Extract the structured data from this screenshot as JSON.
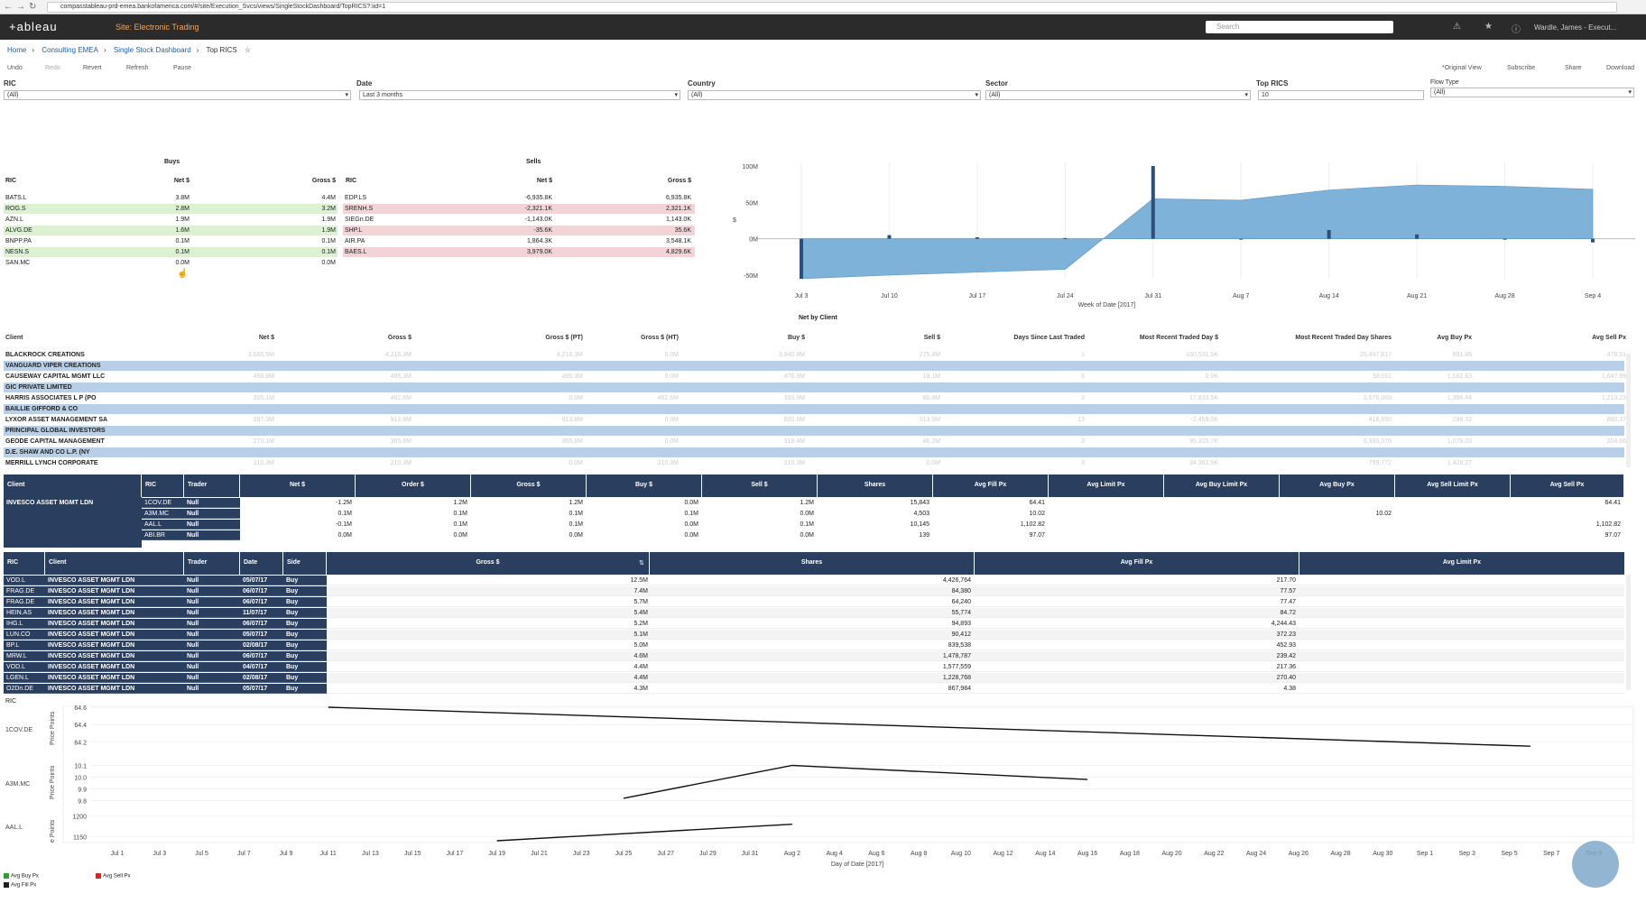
{
  "browser": {
    "url": "compasstableau-prd-emea.bankofamerica.com/#/site/Execution_Svcs/views/SingleStockDashboard/TopRICS?:iid=1"
  },
  "header": {
    "logo": "+ableau",
    "site": "Site: Electronic Trading",
    "search_placeholder": "Search",
    "user": "Wardle, James - Execut..."
  },
  "breadcrumb": {
    "home": "Home",
    "project": "Consulting EMEA",
    "workbook": "Single Stock Dashboard",
    "view": "Top RICS"
  },
  "toolbar": {
    "undo": "Undo",
    "redo": "Redo",
    "revert": "Revert",
    "refresh": "Refresh",
    "pause": "Pause",
    "original_view": "*Original View",
    "subscribe": "Subscribe",
    "share": "Share",
    "download": "Download"
  },
  "filters": {
    "ric": {
      "label": "RIC",
      "value": "(All)"
    },
    "date": {
      "label": "Date",
      "value": "Last 3 months"
    },
    "country": {
      "label": "Country",
      "value": "(All)"
    },
    "sector": {
      "label": "Sector",
      "value": "(All)"
    },
    "top_rics": {
      "label": "Top RICS",
      "value": "10"
    },
    "flow_type": {
      "label": "Flow Type",
      "value": "(All)"
    }
  },
  "buys": {
    "title": "Buys",
    "headers": [
      "RIC",
      "Net $",
      "Gross $"
    ],
    "rows": [
      [
        "BATS.L",
        "3.8M",
        "4.4M"
      ],
      [
        "ROG.S",
        "2.8M",
        "3.2M"
      ],
      [
        "AZN.L",
        "1.9M",
        "1.9M"
      ],
      [
        "ALVG.DE",
        "1.6M",
        "1.9M"
      ],
      [
        "BNPP.PA",
        "0.1M",
        "0.1M"
      ],
      [
        "NESN.S",
        "0.1M",
        "0.1M"
      ],
      [
        "SAN.MC",
        "0.0M",
        "0.0M"
      ]
    ]
  },
  "sells": {
    "title": "Sells",
    "headers": [
      "RIC",
      "Net $",
      "Gross $"
    ],
    "rows": [
      [
        "EDP.LS",
        "-6,935.8K",
        "6,935.8K"
      ],
      [
        "SRENH.S",
        "-2,321.1K",
        "2,321.1K"
      ],
      [
        "SIEGn.DE",
        "-1,143.0K",
        "1,143.0K"
      ],
      [
        "SHP.L",
        "-35.6K",
        "35.6K"
      ],
      [
        "AIR.PA",
        "1,864.3K",
        "3,548.1K"
      ],
      [
        "BAES.L",
        "3,979.0K",
        "4,829.6K"
      ]
    ]
  },
  "chart_data": [
    {
      "type": "area",
      "x": [
        "Jul 3",
        "Jul 10",
        "Jul 17",
        "Jul 24",
        "Jul 31",
        "Aug 7",
        "Aug 14",
        "Aug 21",
        "Aug 28",
        "Sep 4"
      ],
      "series": [
        {
          "values": [
            -55,
            -50,
            -46,
            -42,
            55,
            53,
            67,
            74,
            72,
            68
          ]
        }
      ],
      "bars": [
        -55,
        5,
        2,
        1,
        100,
        0,
        12,
        6,
        0,
        -5
      ],
      "ylabel": "$",
      "xlabel": "Week of Date [2017]",
      "yticks": [
        "100M",
        "50M",
        "0M",
        "-50M"
      ],
      "ylim": [
        -55,
        105
      ],
      "color": "#7fb2d9"
    },
    {
      "type": "line",
      "xlabel": "Day of Date [2017]",
      "row_header": "RIC",
      "x_ticks": [
        "Jul 1",
        "Jul 3",
        "Jul 5",
        "Jul 7",
        "Jul 9",
        "Jul 11",
        "Jul 13",
        "Jul 15",
        "Jul 17",
        "Jul 19",
        "Jul 21",
        "Jul 23",
        "Jul 25",
        "Jul 27",
        "Jul 29",
        "Jul 31",
        "Aug 2",
        "Aug 4",
        "Aug 6",
        "Aug 8",
        "Aug 10",
        "Aug 12",
        "Aug 14",
        "Aug 16",
        "Aug 18",
        "Aug 20",
        "Aug 22",
        "Aug 24",
        "Aug 26",
        "Aug 28",
        "Aug 30",
        "Sep 1",
        "Sep 3",
        "Sep 5",
        "Sep 7",
        "Sep 9"
      ],
      "panels": [
        {
          "ric": "1COV.DE",
          "ylabel": "Price Points",
          "yticks": [
            "64.6",
            "64.4",
            "64.2"
          ],
          "ylim": [
            64.1,
            64.6
          ],
          "x": [
            "Jul 11",
            "Sep 6"
          ],
          "values": [
            64.6,
            64.15
          ]
        },
        {
          "ric": "A3M.MC",
          "ylabel": "Price Points",
          "yticks": [
            "10.1",
            "10.0",
            "9.9",
            "9.8"
          ],
          "ylim": [
            9.75,
            10.15
          ],
          "x": [
            "Jul 25",
            "Aug 2",
            "Aug 16"
          ],
          "values": [
            9.82,
            10.1,
            9.98
          ]
        },
        {
          "ric": "AAL.L",
          "ylabel": "e Points",
          "yticks": [
            "1200",
            "1150"
          ],
          "ylim": [
            1140,
            1210
          ],
          "x": [
            "Jul 19",
            "Aug 2"
          ],
          "values": [
            1140,
            1180
          ]
        }
      ],
      "legend": [
        {
          "name": "Avg Buy Px",
          "color": "#2ca02c"
        },
        {
          "name": "Avg Sell Px",
          "color": "#d62728"
        },
        {
          "name": "Avg Fill Px",
          "color": "#222222"
        }
      ]
    }
  ],
  "net_by_client": {
    "title": "Net by Client",
    "headers": [
      "Client",
      "Net $",
      "Gross $",
      "Gross $ (PT)",
      "Gross $ (HT)",
      "Buy $",
      "Sell $",
      "Days Since Last Traded",
      "Most Recent Traded Day $",
      "Most Recent Traded Day Shares",
      "Avg Buy Px",
      "Avg Sell Px"
    ],
    "rows": [
      [
        "BLACKROCK CREATIONS",
        "3,665.5M",
        "4,216.3M",
        "4,216.3M",
        "0.0M",
        "3,940.9M",
        "275.4M",
        "1",
        "160,531.5K",
        "25,497,817",
        "691.86",
        "478.51"
      ],
      [
        "VANGUARD VIPER CREATIONS",
        "",
        "",
        "",
        "",
        "",
        "",
        "",
        "",
        "",
        "",
        ""
      ],
      [
        "CAUSEWAY CAPITAL MGMT LLC",
        "458.8M",
        "495.3M",
        "495.3M",
        "0.0M",
        "476.9M",
        "18.1M",
        "6",
        "0.0K",
        "58,011",
        "1,182.83",
        "1,647.99"
      ],
      [
        "GIC PRIVATE LIMITED",
        "",
        "",
        "",
        "",
        "",
        "",
        "",
        "",
        "",
        "",
        ""
      ],
      [
        "HARRIS ASSOCIATES L P (PO",
        "305.1M",
        "482.6M",
        "0.0M",
        "482.6M",
        "393.9M",
        "88.8M",
        "3",
        "17,833.5K",
        "2,570,069",
        "1,366.44",
        "1,213.23"
      ],
      [
        "BAILLIE GIFFORD & CO",
        "",
        "",
        "",
        "",
        "",
        "",
        "",
        "",
        "",
        "",
        ""
      ],
      [
        "LYXOR ASSET MANAGEMENT SA",
        "287.3M",
        "913.8M",
        "913.8M",
        "0.0M",
        "600.6M",
        "313.5M",
        "13",
        "-2,459.0K",
        "418,650",
        "298.32",
        "880.37"
      ],
      [
        "PRINCIPAL GLOBAL INVESTORS",
        "",
        "",
        "",
        "",
        "",
        "",
        "",
        "",
        "",
        "",
        ""
      ],
      [
        "GEODE CAPITAL MANAGEMENT",
        "273.1M",
        "365.6M",
        "365.6M",
        "0.0M",
        "319.4M",
        "46.2M",
        "3",
        "95,325.7K",
        "6,393,076",
        "1,079.03",
        "204.66"
      ],
      [
        "D.E. SHAW AND CO L.P. (NY",
        "",
        "",
        "",
        "",
        "",
        "",
        "",
        "",
        "",
        "",
        ""
      ],
      [
        "MERRILL LYNCH CORPORATE",
        "210.3M",
        "210.3M",
        "0.0M",
        "210.3M",
        "210.3M",
        "0.0M",
        "3",
        "34,362.5K",
        "799,772",
        "1,428.27",
        ""
      ]
    ]
  },
  "client_detail": {
    "headers": [
      "Client",
      "RIC",
      "Trader",
      "Net $",
      "Order $",
      "Gross $",
      "Buy $",
      "Sell $",
      "Shares",
      "Avg Fill Px",
      "Avg Limit Px",
      "Avg Buy Limit Px",
      "Avg Buy Px",
      "Avg Sell Limit Px",
      "Avg Sell Px"
    ],
    "client": "INVESCO ASSET MGMT LDN",
    "rows": [
      [
        "1COV.DE",
        "Null",
        "-1.2M",
        "1.2M",
        "1.2M",
        "0.0M",
        "1.2M",
        "15,843",
        "64.41",
        "",
        "",
        "",
        "",
        "64.41"
      ],
      [
        "A3M.MC",
        "Null",
        "0.1M",
        "0.1M",
        "0.1M",
        "0.1M",
        "0.0M",
        "4,503",
        "10.02",
        "",
        "",
        "10.02",
        "",
        ""
      ],
      [
        "AAL.L",
        "Null",
        "-0.1M",
        "0.1M",
        "0.1M",
        "0.0M",
        "0.1M",
        "10,145",
        "1,102.82",
        "",
        "",
        "",
        "",
        "1,102.82"
      ],
      [
        "ABI.BR",
        "Null",
        "0.0M",
        "0.0M",
        "0.0M",
        "0.0M",
        "0.0M",
        "139",
        "97.07",
        "",
        "",
        "",
        "",
        "97.07"
      ]
    ]
  },
  "trades": {
    "headers": [
      "RIC",
      "Client",
      "Trader",
      "Date",
      "Side",
      "Gross $",
      "Shares",
      "Avg Fill Px",
      "Avg Limit Px"
    ],
    "rows": [
      [
        "VOD.L",
        "INVESCO ASSET MGMT LDN",
        "Null",
        "05/07/17",
        "Buy",
        "12.5M",
        "4,426,764",
        "217.70"
      ],
      [
        "FRAG.DE",
        "INVESCO ASSET MGMT LDN",
        "Null",
        "06/07/17",
        "Buy",
        "7.4M",
        "84,380",
        "77.57"
      ],
      [
        "FRAG.DE",
        "INVESCO ASSET MGMT LDN",
        "Null",
        "06/07/17",
        "Buy",
        "5.7M",
        "64,240",
        "77.47"
      ],
      [
        "HEIN.AS",
        "INVESCO ASSET MGMT LDN",
        "Null",
        "11/07/17",
        "Buy",
        "5.4M",
        "55,774",
        "84.72"
      ],
      [
        "IHG.L",
        "INVESCO ASSET MGMT LDN",
        "Null",
        "06/07/17",
        "Buy",
        "5.2M",
        "94,893",
        "4,244.43"
      ],
      [
        "LUN.CO",
        "INVESCO ASSET MGMT LDN",
        "Null",
        "05/07/17",
        "Buy",
        "5.1M",
        "90,412",
        "372.23"
      ],
      [
        "BP.L",
        "INVESCO ASSET MGMT LDN",
        "Null",
        "02/08/17",
        "Buy",
        "5.0M",
        "839,538",
        "452.93"
      ],
      [
        "MRW.L",
        "INVESCO ASSET MGMT LDN",
        "Null",
        "06/07/17",
        "Buy",
        "4.6M",
        "1,478,787",
        "239.42"
      ],
      [
        "VOD.L",
        "INVESCO ASSET MGMT LDN",
        "Null",
        "04/07/17",
        "Buy",
        "4.4M",
        "1,577,559",
        "217.36"
      ],
      [
        "LGEN.L",
        "INVESCO ASSET MGMT LDN",
        "Null",
        "02/08/17",
        "Buy",
        "4.4M",
        "1,228,768",
        "270.40"
      ],
      [
        "O2Dn.DE",
        "INVESCO ASSET MGMT LDN",
        "Null",
        "05/07/17",
        "Buy",
        "4.3M",
        "867,984",
        "4.38"
      ]
    ]
  }
}
